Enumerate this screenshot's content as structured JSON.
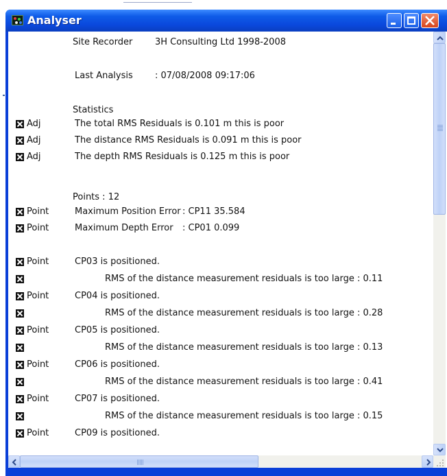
{
  "window": {
    "title": "Analyser",
    "colors": {
      "titlebar": "#0a48dc",
      "close": "#d8451c",
      "check": "#111111"
    }
  },
  "header": {
    "app": "Site Recorder",
    "company": "3H Consulting Ltd 1998-2008",
    "last_analysis_label": "Last Analysis",
    "last_analysis_value": ":  07/08/2008 09:17:06"
  },
  "statistics": {
    "heading": "Statistics",
    "rows": [
      {
        "tag": "Adj",
        "text": "The total RMS Residuals is 0.101 m this is poor"
      },
      {
        "tag": "Adj",
        "text": "The distance RMS Residuals is 0.091 m this is poor"
      },
      {
        "tag": "Adj",
        "text": "The depth RMS Residuals is 0.125 m this is poor"
      }
    ]
  },
  "points": {
    "heading": "Points : 12",
    "max_rows": [
      {
        "tag": "Point",
        "label": "Maximum Position Error",
        "value": ": CP11  35.584"
      },
      {
        "tag": "Point",
        "label": "Maximum Depth Error",
        "value": ": CP01  0.099"
      }
    ],
    "details": [
      {
        "tag": "Point",
        "text": "CP03 is positioned.",
        "indent": false
      },
      {
        "tag": "",
        "text": "RMS of the distance measurement residuals is too large : 0.11",
        "indent": true
      },
      {
        "tag": "Point",
        "text": "CP04 is positioned.",
        "indent": false
      },
      {
        "tag": "",
        "text": "RMS of the distance measurement residuals is too large : 0.28",
        "indent": true
      },
      {
        "tag": "Point",
        "text": "CP05 is positioned.",
        "indent": false
      },
      {
        "tag": "",
        "text": "RMS of the distance measurement residuals is too large : 0.13",
        "indent": true
      },
      {
        "tag": "Point",
        "text": "CP06 is positioned.",
        "indent": false
      },
      {
        "tag": "",
        "text": "RMS of the distance measurement residuals is too large : 0.41",
        "indent": true
      },
      {
        "tag": "Point",
        "text": "CP07 is positioned.",
        "indent": false
      },
      {
        "tag": "",
        "text": "RMS of the distance measurement residuals is too large : 0.15",
        "indent": true
      },
      {
        "tag": "Point",
        "text": "CP09 is positioned.",
        "indent": false
      }
    ]
  }
}
